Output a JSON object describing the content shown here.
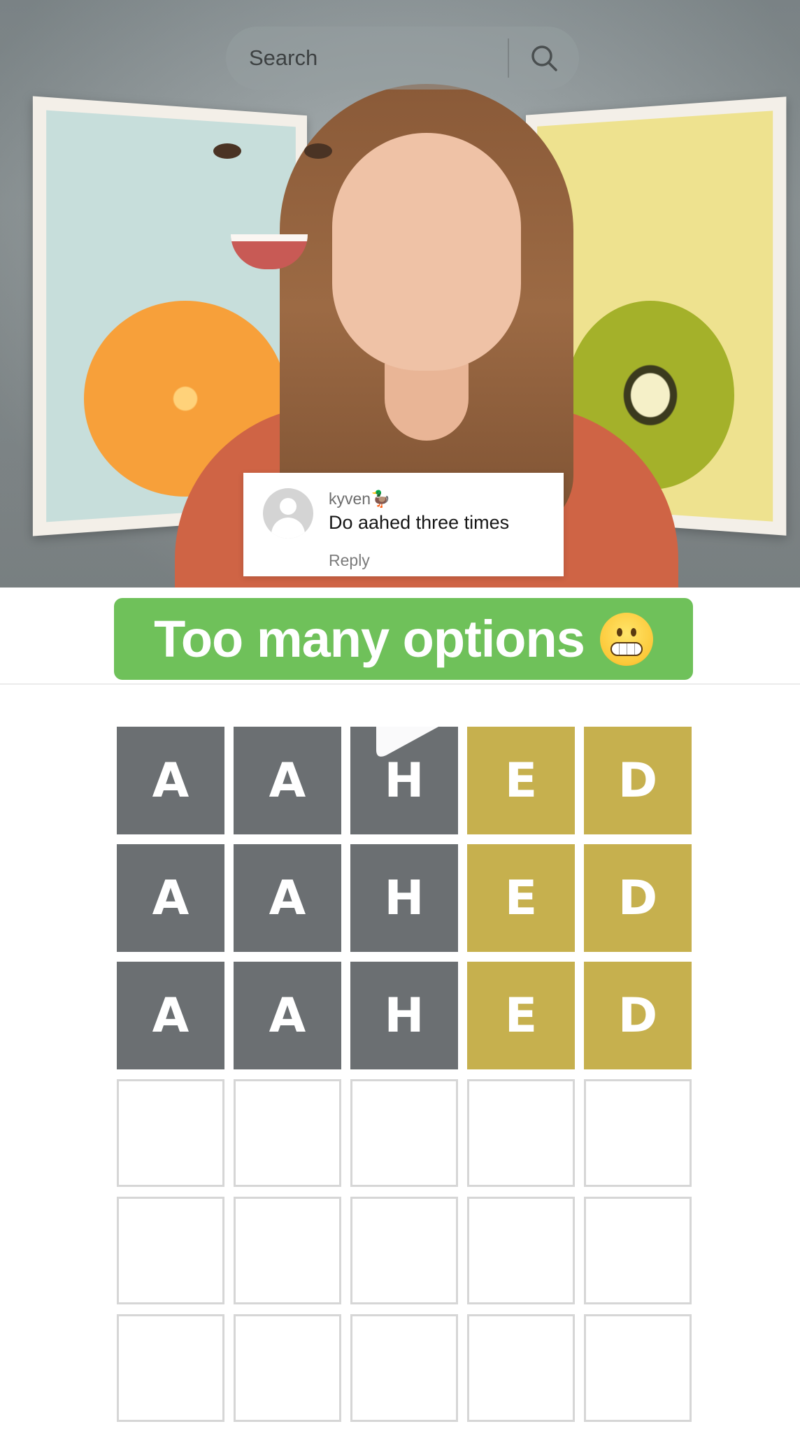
{
  "search": {
    "placeholder": "Search"
  },
  "comment": {
    "username": "kyven🦆",
    "text": "Do aahed three times",
    "reply_label": "Reply"
  },
  "caption": {
    "text": "Too many options",
    "emoji": "grimacing-face"
  },
  "wordle": {
    "rows": [
      {
        "letters": [
          "A",
          "A",
          "H",
          "E",
          "D"
        ],
        "states": [
          "absent",
          "absent",
          "absent",
          "present",
          "present"
        ]
      },
      {
        "letters": [
          "A",
          "A",
          "H",
          "E",
          "D"
        ],
        "states": [
          "absent",
          "absent",
          "absent",
          "present",
          "present"
        ]
      },
      {
        "letters": [
          "A",
          "A",
          "H",
          "E",
          "D"
        ],
        "states": [
          "absent",
          "absent",
          "absent",
          "present",
          "present"
        ]
      },
      {
        "letters": [
          "",
          "",
          "",
          "",
          ""
        ],
        "states": [
          "empty",
          "empty",
          "empty",
          "empty",
          "empty"
        ]
      },
      {
        "letters": [
          "",
          "",
          "",
          "",
          ""
        ],
        "states": [
          "empty",
          "empty",
          "empty",
          "empty",
          "empty"
        ]
      },
      {
        "letters": [
          "",
          "",
          "",
          "",
          ""
        ],
        "states": [
          "empty",
          "empty",
          "empty",
          "empty",
          "empty"
        ]
      }
    ]
  },
  "colors": {
    "caption_bg": "#6fc15a",
    "absent": "#6b6f72",
    "present": "#c6b04e"
  }
}
